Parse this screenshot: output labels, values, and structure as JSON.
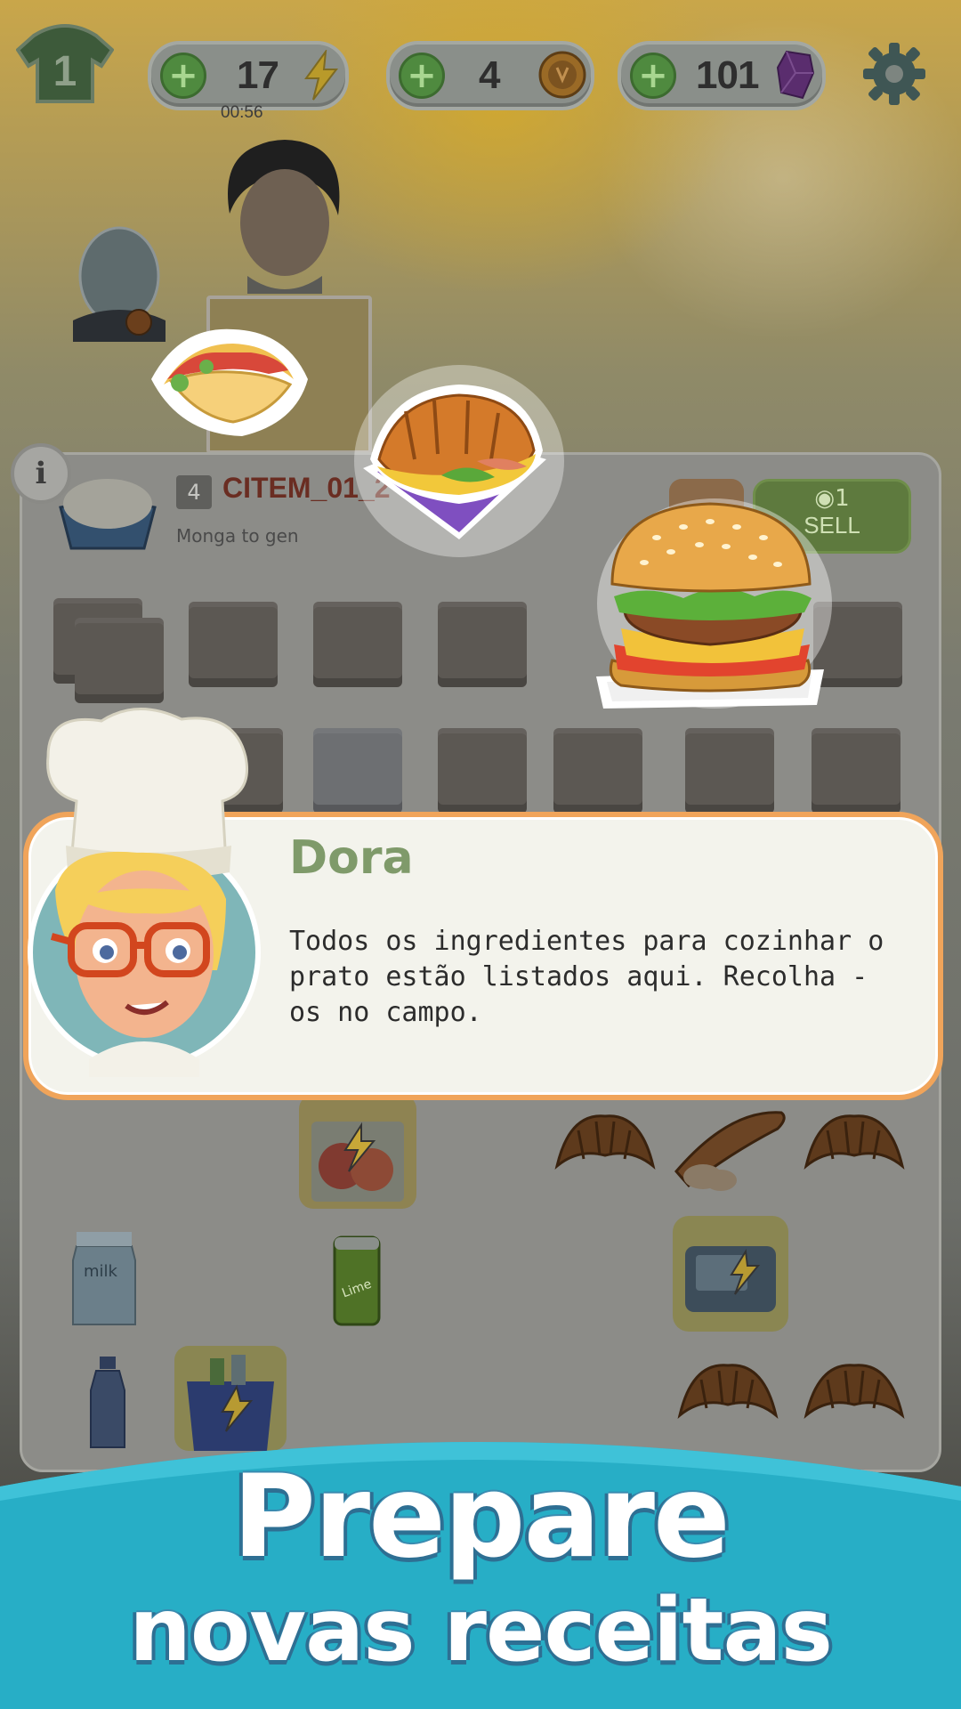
{
  "hud": {
    "level": "1",
    "energy": "17",
    "energy_timer": "00:56",
    "coins": "4",
    "gems": "101"
  },
  "item_panel": {
    "level": "4",
    "code": "CITEM_01_2",
    "subtitle": "Monga to gen",
    "sell_price": "1",
    "sell_label": "SELL"
  },
  "dialog": {
    "speaker": "Dora",
    "text": "Todos os ingredientes para cozinhar o prato estão listados aqui. Recolha - os no campo."
  },
  "banner": {
    "line1": "Prepare",
    "line2": "novas receitas"
  },
  "board_items": {
    "milk_label": "milk",
    "can_label": "Lime"
  },
  "colors": {
    "accent_orange": "#f0a45a",
    "banner_teal": "#27aec6",
    "speaker_green": "#7f9a6a"
  }
}
